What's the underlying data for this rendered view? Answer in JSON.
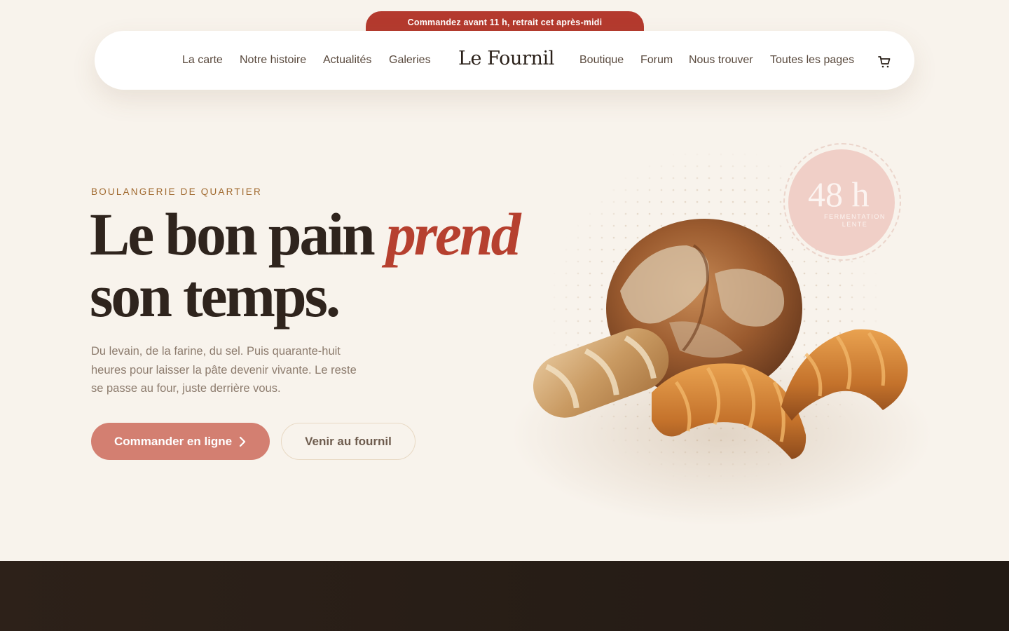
{
  "promo": {
    "text": "Commandez avant 11 h, retrait cet après-midi"
  },
  "nav": {
    "left_items": [
      "La carte",
      "Notre histoire",
      "Actualités",
      "Galeries"
    ],
    "brand": "Le Fournil",
    "right_items": [
      "Boutique",
      "Forum",
      "Nous trouver",
      "Toutes les pages"
    ],
    "cart_icon": "cart-icon"
  },
  "hero": {
    "eyebrow": "BOULANGERIE DE QUARTIER",
    "headline_part1": "Le bon pain ",
    "headline_accent": "prend",
    "headline_part2": "son temps.",
    "lede": "Du levain, de la farine, du sel. Puis quarante-huit heures pour laisser la pâte devenir vivante. Le reste se passe au four, juste derrière vous.",
    "primary_cta": "Commander en ligne",
    "secondary_cta": "Venir au fournil"
  },
  "badge": {
    "value": "48 h",
    "caption": "FERMENTATION LENTE"
  },
  "colors": {
    "background": "#f8f3ec",
    "accent_red": "#b43a2e",
    "primary_button": "#d37f71",
    "eyebrow": "#a0692e",
    "dark_band": "#2d2119"
  }
}
